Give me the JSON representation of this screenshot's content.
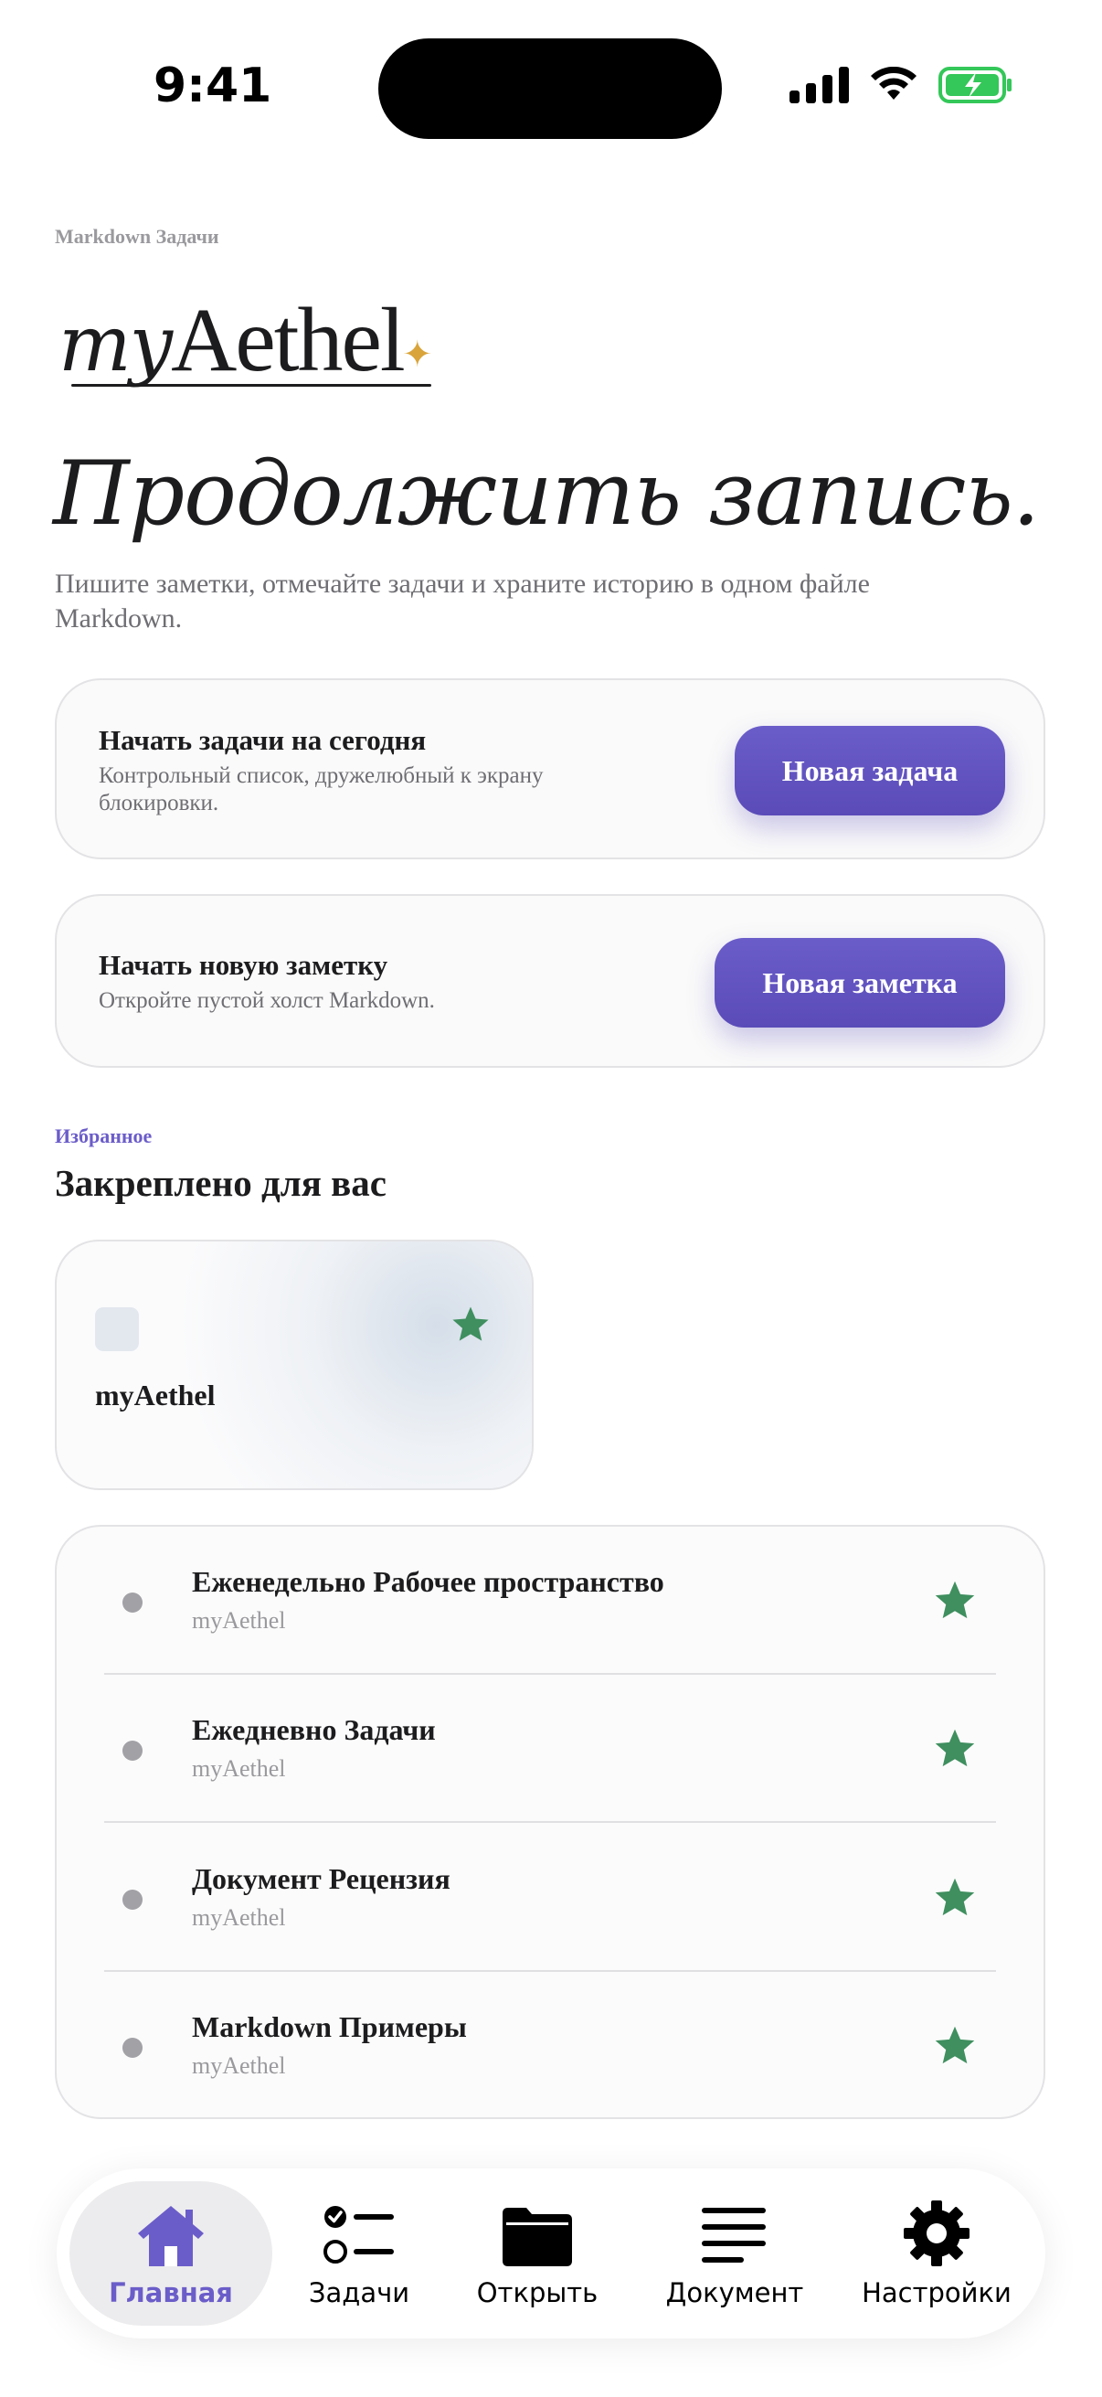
{
  "status_bar": {
    "time": "9:41"
  },
  "header": {
    "eyebrow": "Markdown Задачи",
    "logo_script": "my",
    "logo_rest": "Aethel",
    "title": "Продолжить запись.",
    "subtitle": "Пишите заметки, отмечайте задачи и храните историю в одном файле Markdown."
  },
  "cards": {
    "tasks": {
      "title": "Начать задачи на сегодня",
      "description": "Контрольный список, дружелюбный к экрану блокировки.",
      "button": "Новая задача"
    },
    "note": {
      "title": "Начать новую заметку",
      "description": "Откройте пустой холст Markdown.",
      "button": "Новая заметка"
    }
  },
  "favorites": {
    "eyebrow": "Избранное",
    "title": "Закреплено для вас",
    "pinned": {
      "name": "myAethel",
      "icon": "star-icon"
    }
  },
  "list": {
    "items": [
      {
        "title": "Еженедельно Рабочее пространство",
        "subtitle": "myAethel",
        "starred": true
      },
      {
        "title": "Ежедневно Задачи",
        "subtitle": "myAethel",
        "starred": true
      },
      {
        "title": "Документ Рецензия",
        "subtitle": "myAethel",
        "starred": true
      },
      {
        "title": "Markdown Примеры",
        "subtitle": "myAethel",
        "starred": true
      }
    ]
  },
  "tabbar": {
    "tabs": [
      {
        "label": "Главная",
        "icon": "home-icon",
        "active": true
      },
      {
        "label": "Задачи",
        "icon": "checklist-icon",
        "active": false
      },
      {
        "label": "Открыть",
        "icon": "folder-icon",
        "active": false
      },
      {
        "label": "Документ",
        "icon": "document-lines-icon",
        "active": false
      },
      {
        "label": "Настройки",
        "icon": "gear-icon",
        "active": false
      }
    ]
  },
  "colors": {
    "accent": "#6b5dc9",
    "star": "#3f8f5f",
    "spark": "#d9a43a"
  }
}
